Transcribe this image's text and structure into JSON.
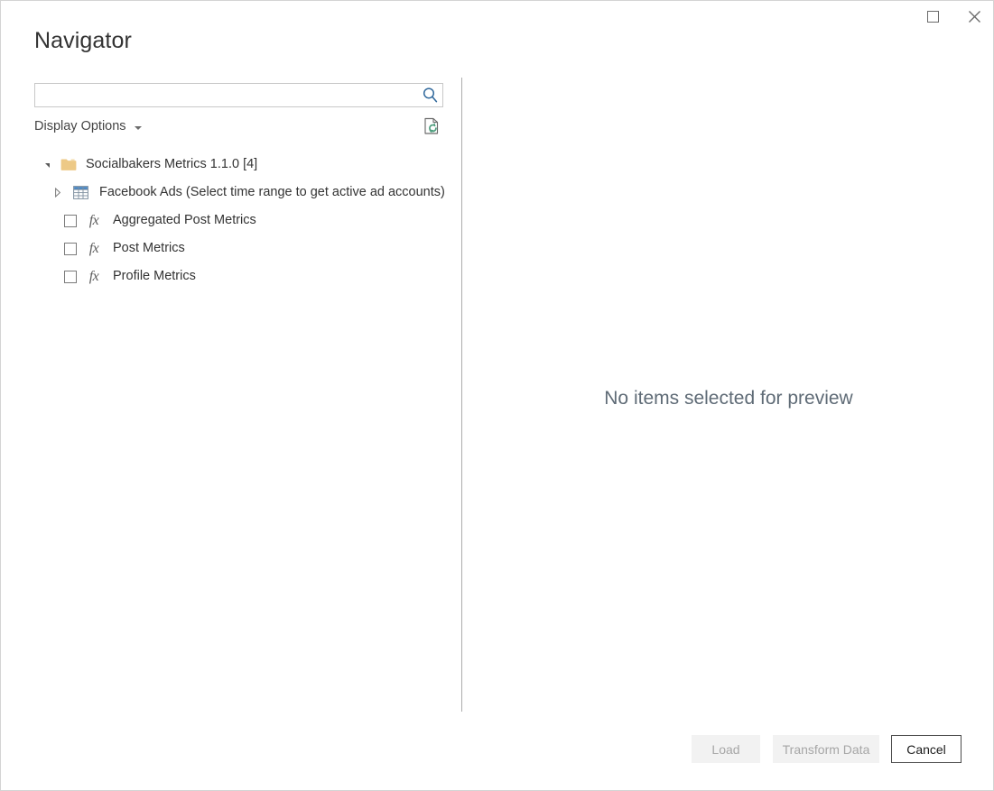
{
  "window": {
    "title": "Navigator",
    "controls": [
      {
        "name": "maximize",
        "label": "Maximize",
        "glyph": "maximize-icon"
      },
      {
        "name": "close",
        "label": "Close",
        "glyph": "close-icon"
      }
    ]
  },
  "search": {
    "value": "",
    "placeholder": "",
    "icon": "search-icon"
  },
  "toolbar": {
    "display_options_label": "Display Options",
    "display_options_icon": "chevron-down-icon",
    "refresh_icon": "refresh-document-icon",
    "refresh_tooltip": "Refresh"
  },
  "tree": {
    "nodes": [
      {
        "label": "Socialbakers Metrics 1.1.0 [4]",
        "level": 0,
        "kind": "folder",
        "icon": "folder-icon",
        "twisty": "expanded",
        "has_checkbox": false
      },
      {
        "label": "Facebook Ads (Select time range to get active ad accounts)",
        "level": 1,
        "kind": "table",
        "icon": "table-icon",
        "twisty": "collapsed",
        "has_checkbox": false
      },
      {
        "label": "Aggregated Post Metrics",
        "level": 1,
        "kind": "function",
        "icon": "fx-icon",
        "twisty": "none",
        "has_checkbox": true,
        "checked": false
      },
      {
        "label": "Post Metrics",
        "level": 1,
        "kind": "function",
        "icon": "fx-icon",
        "twisty": "none",
        "has_checkbox": true,
        "checked": false
      },
      {
        "label": "Profile Metrics",
        "level": 1,
        "kind": "function",
        "icon": "fx-icon",
        "twisty": "none",
        "has_checkbox": true,
        "checked": false
      }
    ]
  },
  "preview": {
    "empty_message": "No items selected for preview"
  },
  "footer": {
    "buttons": [
      {
        "name": "load",
        "label": "Load",
        "state": "disabled"
      },
      {
        "name": "transform-data",
        "label": "Transform Data",
        "state": "disabled"
      },
      {
        "name": "cancel",
        "label": "Cancel",
        "state": "default"
      }
    ]
  },
  "colors": {
    "accent_blue": "#31699c",
    "folder_gold": "#edc986",
    "table_header_blue": "#4a87c4",
    "refresh_green": "#4e9e7e",
    "title_text": "#333333",
    "preview_text": "#5f6b76",
    "divider": "#adadad"
  }
}
